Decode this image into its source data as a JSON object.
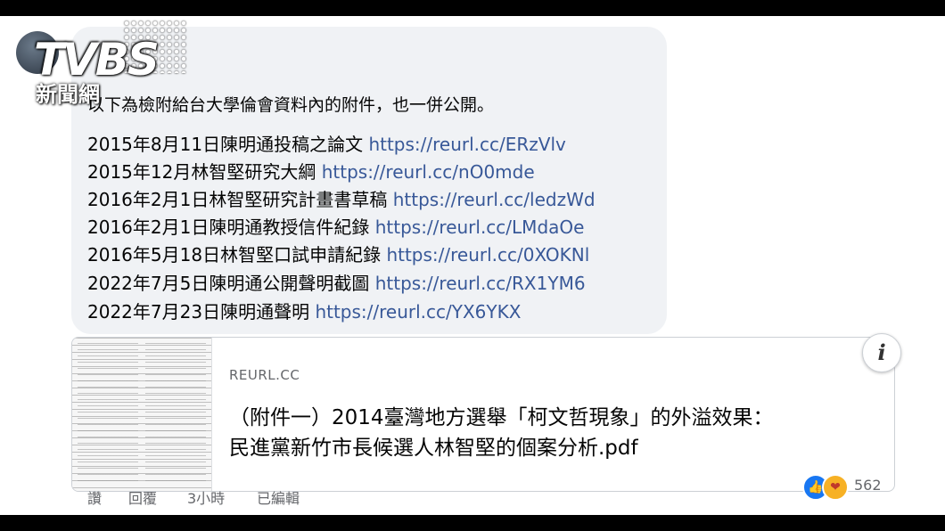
{
  "watermark": {
    "brand": "TVBS",
    "sub": "新聞網"
  },
  "comment": {
    "intro": "以下為檢附給台大學倫會資料內的附件，也一併公開。",
    "lines": [
      {
        "text": "2015年8月11日陳明通投稿之論文 ",
        "link": "https://reurl.cc/ERzVlv"
      },
      {
        "text": "2015年12月林智堅研究大綱 ",
        "link": "https://reurl.cc/nO0mde"
      },
      {
        "text": "2016年2月1日林智堅研究計畫書草稿 ",
        "link": "https://reurl.cc/ledzWd"
      },
      {
        "text": "2016年2月1日陳明通教授信件紀錄 ",
        "link": "https://reurl.cc/LMdaOe"
      },
      {
        "text": "2016年5月18日林智堅口試申請紀錄 ",
        "link": "https://reurl.cc/0XOKNl"
      },
      {
        "text": "2022年7月5日陳明通公開聲明截圖 ",
        "link": "https://reurl.cc/RX1YM6"
      },
      {
        "text": "2022年7月23日陳明通聲明 ",
        "link": "https://reurl.cc/YX6YKX"
      }
    ]
  },
  "preview": {
    "domain": "REURL.CC",
    "title_line1": "（附件一）2014臺灣地方選舉「柯文哲現象」的外溢效果：",
    "title_line2": "民進黨新竹市長候選人林智堅的個案分析.pdf",
    "info_label": "i"
  },
  "actions": {
    "like": "讚",
    "reply": "回覆",
    "time": "3小時",
    "edited": "已編輯"
  },
  "reactions": {
    "count": "562",
    "icons": [
      "like-icon",
      "care-icon"
    ]
  }
}
